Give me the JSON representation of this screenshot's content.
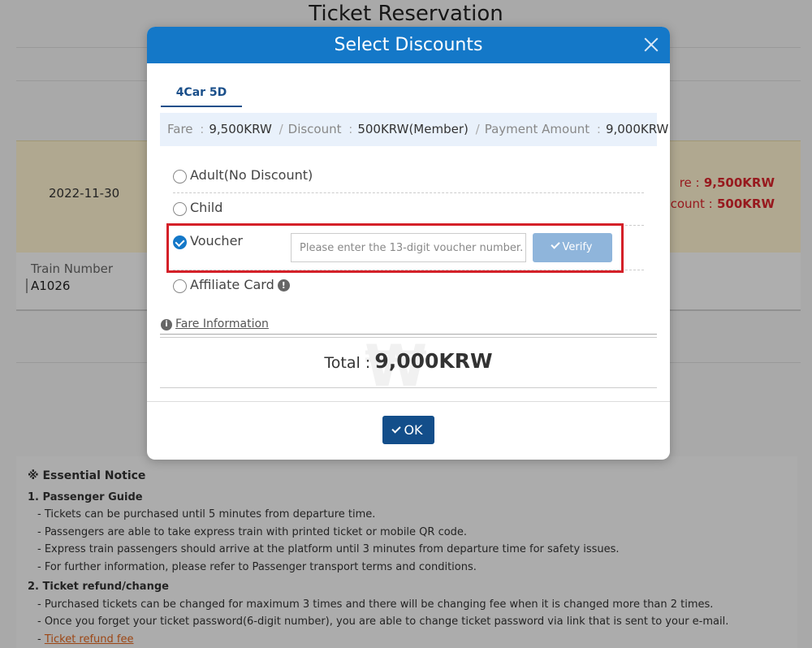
{
  "background": {
    "title": "Ticket Reservation",
    "date": "2022-11-30",
    "fare_label_partial": "re :",
    "fare_value": "9,500KRW",
    "discount_label_partial": "scount :",
    "discount_value": "500KRW",
    "train_number_label": "Train Number",
    "train_number_value": "A1026",
    "notice": {
      "title": "※ Essential Notice",
      "sections": [
        {
          "heading": "1. Passenger Guide",
          "items": [
            "- Tickets can be purchased until 5 minutes from departure time.",
            "- Passengers are able to take express train with printed ticket or mobile QR code.",
            "- Express train passengers should arrive at the platform until 3 minutes from departure time for safety issues.",
            "- For further information, please refer to Passenger transport terms and conditions."
          ]
        },
        {
          "heading": "2. Ticket refund/change",
          "items": [
            "- Purchased tickets can be changed for maximum 3 times and there will be changing fee when it is changed more than 2 times.",
            "- Once you forget your ticket password(6-digit number), you are able to change ticket password via link that is sent to your e-mail."
          ]
        }
      ],
      "refund_link_prefix": "- ",
      "refund_link": "Ticket refund fee"
    }
  },
  "modal": {
    "title": "Select Discounts",
    "tab_label": "4Car 5D",
    "summary": {
      "fare_label": "Fare",
      "fare_value": "9,500KRW",
      "discount_label": "Discount",
      "discount_value": "500KRW(Member)",
      "payment_label": "Payment Amount",
      "payment_value": "9,000KRW"
    },
    "options": [
      {
        "label": "Adult(No Discount)",
        "checked": false
      },
      {
        "label": "Child",
        "checked": false
      },
      {
        "label": "Voucher",
        "checked": true
      },
      {
        "label": "Affiliate Card",
        "checked": false
      }
    ],
    "voucher_placeholder": "Please enter the 13-digit voucher number.",
    "verify_label": "Verify",
    "fare_info_label": "Fare Information",
    "total_label": "Total :",
    "total_value": "9,000KRW",
    "ok_label": "OK",
    "watermark": "₩"
  },
  "colors": {
    "header_blue": "#1478c8",
    "ok_navy": "#134e8a",
    "highlight_red": "#d42028",
    "price_red": "#d9242b"
  }
}
